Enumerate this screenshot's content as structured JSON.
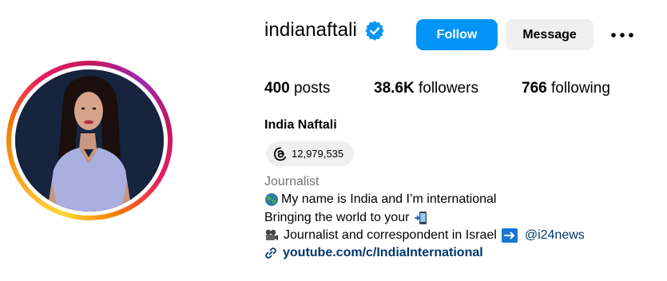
{
  "profile": {
    "username": "indianaftali",
    "full_name": "India Naftali",
    "category": "Journalist",
    "verified": true
  },
  "buttons": {
    "follow": "Follow",
    "message": "Message"
  },
  "stats": {
    "posts_count": "400",
    "posts_label": "posts",
    "followers_count": "38.6K",
    "followers_label": "followers",
    "following_count": "766",
    "following_label": "following"
  },
  "threads": {
    "count": "12,979,535",
    "icon": "threads-icon"
  },
  "bio": {
    "line1": "My name is India and I’m international",
    "line2": "Bringing the world to your",
    "line3": "Journalist and correspondent in Israel",
    "mention": "@i24news"
  },
  "link": {
    "text": "youtube.com/c/IndiaInternational"
  },
  "colors": {
    "primary_blue": "#0095f6",
    "secondary_bg": "#efefef",
    "muted_text": "#737373",
    "link_text": "#00376b"
  }
}
